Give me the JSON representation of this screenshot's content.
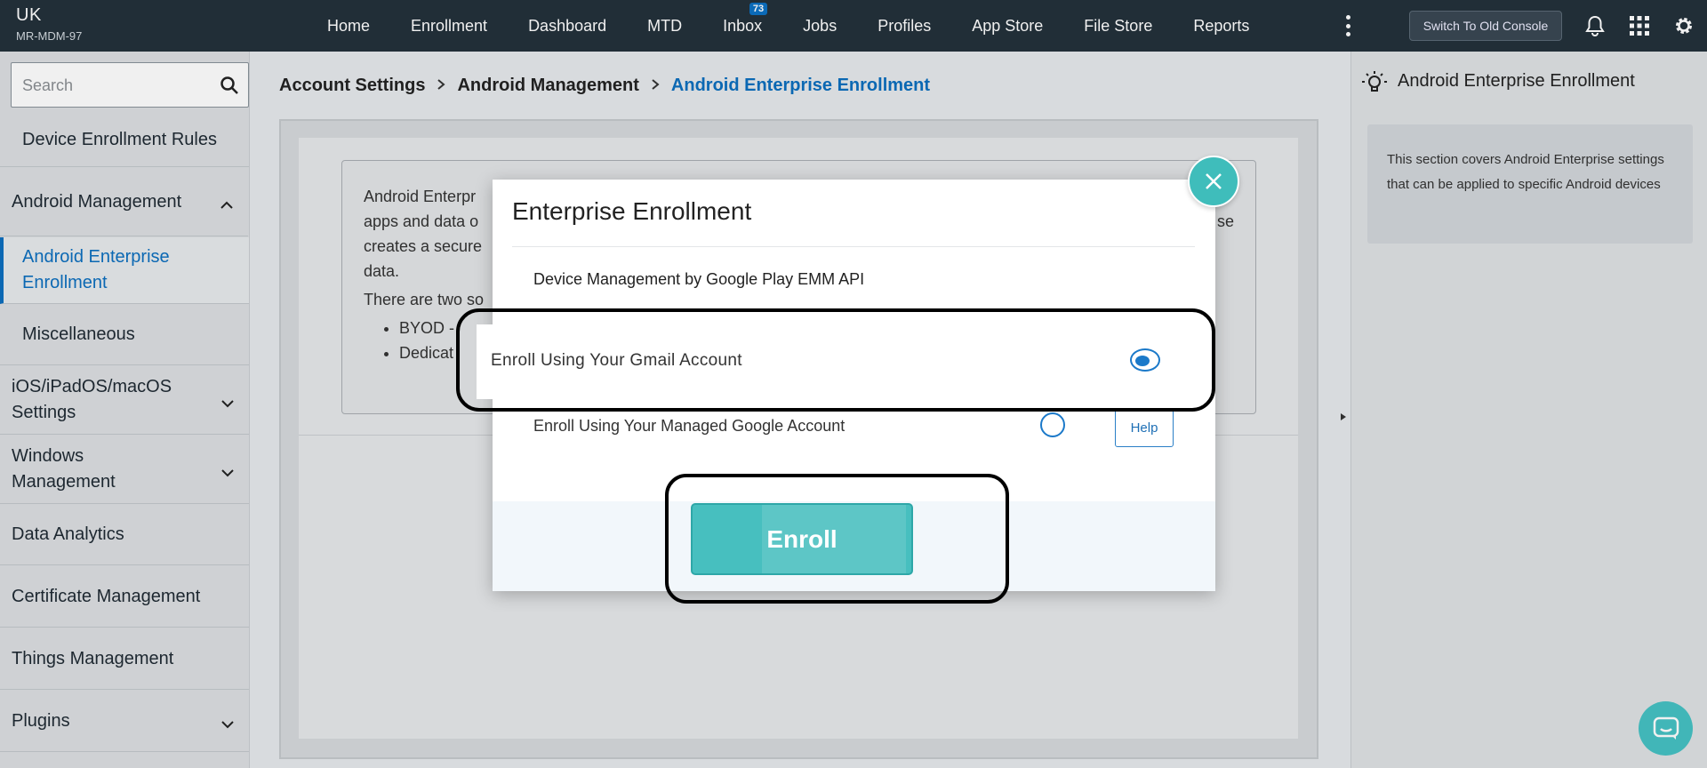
{
  "header": {
    "org": "UK",
    "account": "MR-MDM-97",
    "nav": [
      {
        "label": "Home"
      },
      {
        "label": "Enrollment"
      },
      {
        "label": "Dashboard"
      },
      {
        "label": "MTD"
      },
      {
        "label": "Inbox",
        "badge": "73"
      },
      {
        "label": "Jobs"
      },
      {
        "label": "Profiles"
      },
      {
        "label": "App Store"
      },
      {
        "label": "File Store"
      },
      {
        "label": "Reports"
      }
    ],
    "switch_console": "Switch To Old Console"
  },
  "sidebar": {
    "search_placeholder": "Search",
    "items": [
      {
        "label": "Device Enrollment Rules"
      },
      {
        "label": "Android Management"
      },
      {
        "label": "Android Enterprise Enrollment"
      },
      {
        "label": "Miscellaneous"
      },
      {
        "label": "iOS/iPadOS/macOS Settings"
      },
      {
        "label": "Windows Management"
      },
      {
        "label": "Data Analytics"
      },
      {
        "label": "Certificate Management"
      },
      {
        "label": "Things Management"
      },
      {
        "label": "Plugins"
      }
    ]
  },
  "breadcrumb": {
    "items": [
      "Account Settings",
      "Android Management",
      "Android Enterprise Enrollment"
    ]
  },
  "content": {
    "p1a": "Android Enterpr",
    "p1b": "apps and data o",
    "p1c": "creates a secure",
    "p1d": "data.",
    "p1_tail": "se",
    "p2": "There are two so",
    "bullets": [
      "BYOD -",
      "Dedicat"
    ]
  },
  "right_panel": {
    "title": "Android Enterprise Enrollment",
    "note": "This section covers Android Enterprise settings that can be applied to specific Android devices"
  },
  "modal": {
    "title": "Enterprise Enrollment",
    "subtitle": "Device Management by Google Play EMM API",
    "options": [
      {
        "label": "Enroll Using Your Gmail Account",
        "selected": true
      },
      {
        "label": "Enroll Using Your Managed Google Account",
        "selected": false
      }
    ],
    "help": "Help",
    "enroll": "Enroll"
  },
  "colors": {
    "topbar": "#24313b",
    "accent_blue": "#0c6fbf",
    "teal": "#47bfbf"
  }
}
